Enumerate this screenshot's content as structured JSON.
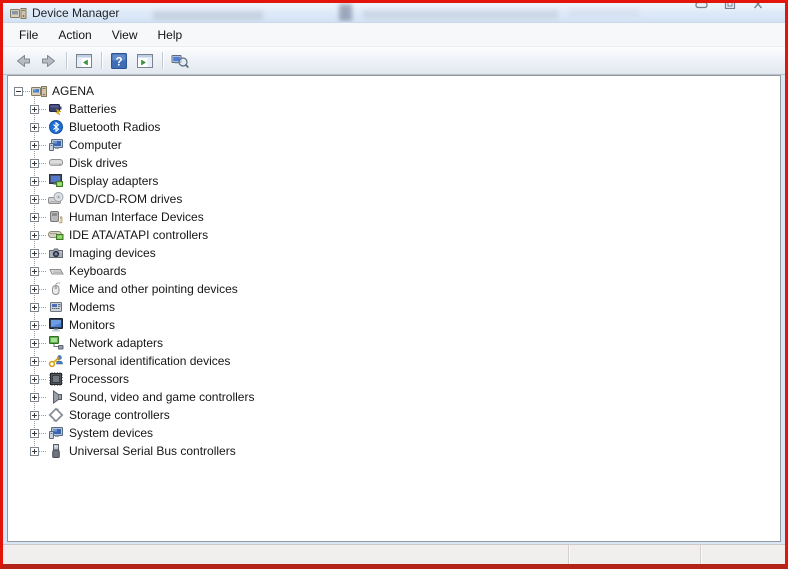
{
  "window": {
    "title": "Device Manager",
    "controls": [
      {
        "name": "minimize",
        "icon": "minimize-icon"
      },
      {
        "name": "restore",
        "icon": "restore-icon"
      },
      {
        "name": "close",
        "icon": "close-icon"
      }
    ]
  },
  "menu": {
    "items": [
      {
        "label": "File"
      },
      {
        "label": "Action"
      },
      {
        "label": "View"
      },
      {
        "label": "Help"
      }
    ]
  },
  "toolbar": {
    "buttons": [
      {
        "name": "back",
        "icon": "back-arrow-icon",
        "separator_after": false
      },
      {
        "name": "forward",
        "icon": "forward-arrow-icon",
        "separator_after": true
      },
      {
        "name": "show-console-tree",
        "icon": "console-tree-icon",
        "separator_after": true
      },
      {
        "name": "help",
        "icon": "help-icon",
        "separator_after": false
      },
      {
        "name": "show-action-pane",
        "icon": "action-pane-icon",
        "separator_after": true
      },
      {
        "name": "scan-hardware-changes",
        "icon": "scan-hardware-icon",
        "separator_after": false
      }
    ]
  },
  "tree": {
    "root": {
      "label": "AGENA",
      "icon": "workstation-icon",
      "state": "expanded"
    },
    "items": [
      {
        "label": "Batteries",
        "icon": "battery-icon",
        "state": "collapsed"
      },
      {
        "label": "Bluetooth Radios",
        "icon": "bluetooth-icon",
        "state": "collapsed"
      },
      {
        "label": "Computer",
        "icon": "computer-icon",
        "state": "collapsed"
      },
      {
        "label": "Disk drives",
        "icon": "disk-drive-icon",
        "state": "collapsed"
      },
      {
        "label": "Display adapters",
        "icon": "display-adapter-icon",
        "state": "collapsed"
      },
      {
        "label": "DVD/CD-ROM drives",
        "icon": "dvd-drive-icon",
        "state": "collapsed"
      },
      {
        "label": "Human Interface Devices",
        "icon": "hid-icon",
        "state": "collapsed"
      },
      {
        "label": "IDE ATA/ATAPI controllers",
        "icon": "ide-controller-icon",
        "state": "collapsed"
      },
      {
        "label": "Imaging devices",
        "icon": "imaging-device-icon",
        "state": "collapsed"
      },
      {
        "label": "Keyboards",
        "icon": "keyboard-icon",
        "state": "collapsed"
      },
      {
        "label": "Mice and other pointing devices",
        "icon": "mouse-icon",
        "state": "collapsed"
      },
      {
        "label": "Modems",
        "icon": "modem-icon",
        "state": "collapsed"
      },
      {
        "label": "Monitors",
        "icon": "monitor-icon",
        "state": "collapsed"
      },
      {
        "label": "Network adapters",
        "icon": "network-adapter-icon",
        "state": "collapsed"
      },
      {
        "label": "Personal identification devices",
        "icon": "id-device-icon",
        "state": "collapsed"
      },
      {
        "label": "Processors",
        "icon": "processor-icon",
        "state": "collapsed"
      },
      {
        "label": "Sound, video and game controllers",
        "icon": "speaker-icon",
        "state": "collapsed"
      },
      {
        "label": "Storage controllers",
        "icon": "storage-controller-icon",
        "state": "collapsed"
      },
      {
        "label": "System devices",
        "icon": "system-device-icon",
        "state": "collapsed"
      },
      {
        "label": "Universal Serial Bus controllers",
        "icon": "usb-icon",
        "state": "collapsed"
      }
    ]
  },
  "statusbar": {
    "panes": [
      "",
      "",
      ""
    ]
  }
}
